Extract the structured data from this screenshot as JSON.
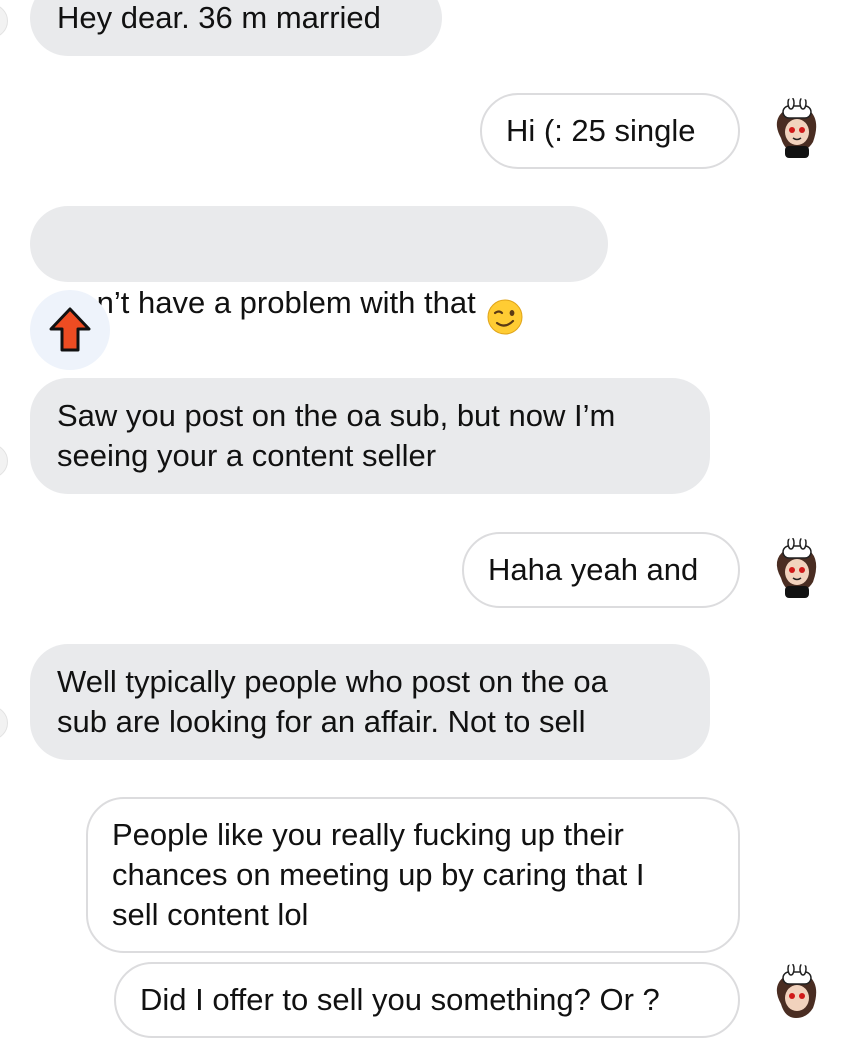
{
  "conversation": {
    "messages": [
      {
        "sender": "them",
        "text": "Hey dear. 36 m married"
      },
      {
        "sender": "me",
        "text": "Hi (: 25 single"
      },
      {
        "sender": "them",
        "text": "Don’t have a problem with that",
        "emoji": "winking-face"
      },
      {
        "sender": "them",
        "text": "Saw you post on the oa sub, but now I’m\nseeing your a content seller"
      },
      {
        "sender": "me",
        "text": "Haha yeah and"
      },
      {
        "sender": "them",
        "text": "Well typically people who post on the oa\nsub are looking for an affair. Not to sell"
      },
      {
        "sender": "me",
        "text": "People like you really fucking up their\nchances on meeting up by caring that I\nsell content lol"
      },
      {
        "sender": "me",
        "text": "Did I offer to sell you something? Or ?"
      }
    ],
    "reaction": {
      "icon": "upvote-arrow-icon",
      "color": "#ee4c22"
    }
  },
  "colors": {
    "incoming_bubble": "#e9eaec",
    "outgoing_border": "#dcdcde",
    "reaction_bg": "#eef3fb"
  }
}
